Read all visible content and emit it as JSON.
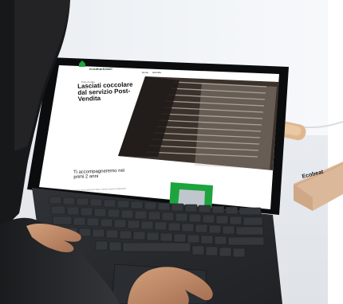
{
  "screen": {
    "brand_name": "ecodharbrasil",
    "nav": [
      "Home",
      "Azienda"
    ],
    "breadcrumb": "Post-vendita",
    "hero_title": "Lasciati coccolare dal servizio Post-Vendita",
    "subtitle": "Ti accompagneremo nei primi 2 anni",
    "small_text": "Fino da 1 anno potrai per l'intero, Servizi sempre il patrimonio"
  },
  "box_label": "Ecobeat"
}
